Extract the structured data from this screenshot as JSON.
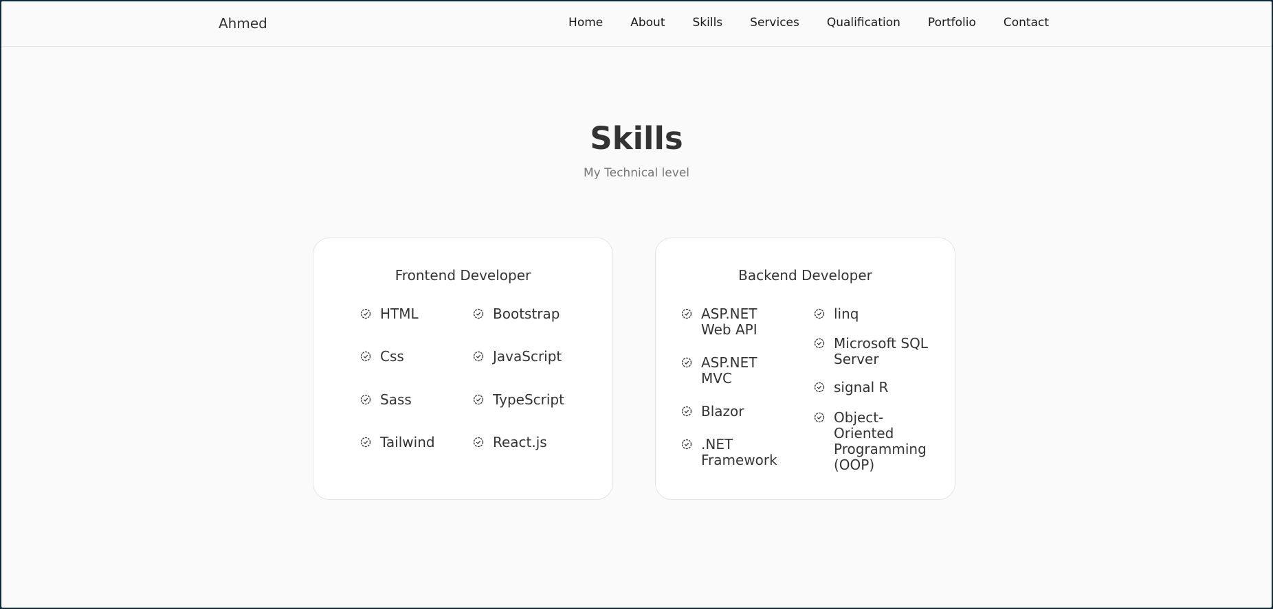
{
  "header": {
    "logo": "Ahmed",
    "nav": [
      "Home",
      "About",
      "Skills",
      "Services",
      "Qualification",
      "Portfolio",
      "Contact"
    ]
  },
  "section": {
    "title": "Skills",
    "subtitle": "My Technical level"
  },
  "frontend": {
    "title": "Frontend Developer",
    "skills": [
      "HTML",
      "Bootstrap",
      "Css",
      "JavaScript",
      "Sass",
      "TypeScript",
      "Tailwind",
      "React.js"
    ]
  },
  "backend": {
    "title": "Backend Developer",
    "skills": [
      "ASP.NET Web API",
      "linq",
      "ASP.NET MVC",
      "Microsoft SQL Server",
      "Blazor",
      "signal R",
      ".NET Framework",
      "Object-Oriented Programming (OOP)"
    ]
  },
  "colors": {
    "background": "#fafafa",
    "card": "#ffffff",
    "text": "#333333",
    "subtitle": "#757575",
    "frame": "#0f2a3a"
  },
  "icons": {
    "skill_icon": "badge-check-icon"
  }
}
